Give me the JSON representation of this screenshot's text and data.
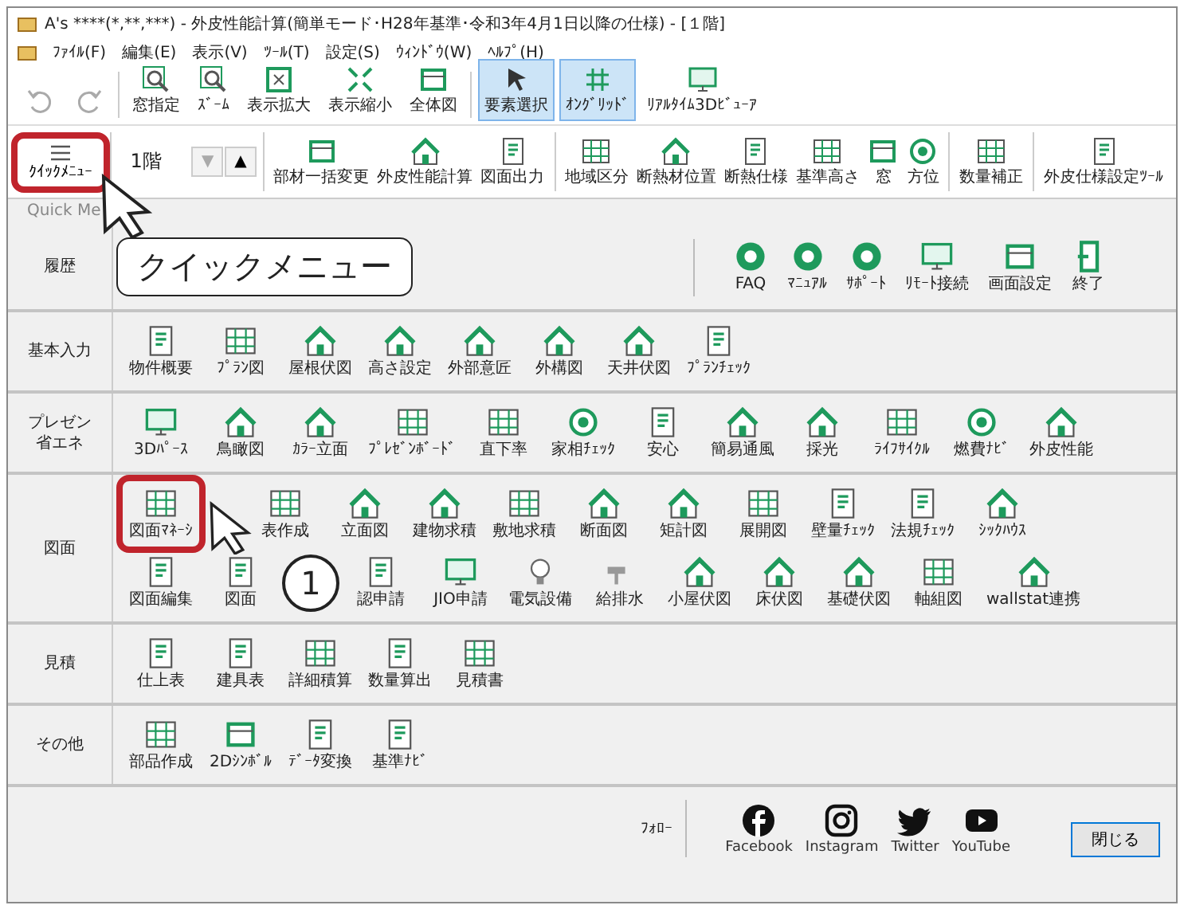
{
  "window": {
    "title": "A's ****(*,**,***) - 外皮性能計算(簡単モード･H28年基準･令和3年4月1日以降の仕様) - [１階]"
  },
  "menu_bar": [
    "ﾌｧｲﾙ(F)",
    "編集(E)",
    "表示(V)",
    "ﾂｰﾙ(T)",
    "設定(S)",
    "ｳｨﾝﾄﾞｳ(W)",
    "ﾍﾙﾌﾟ(H)"
  ],
  "toolbar": [
    {
      "disabled": true,
      "selected": false
    },
    {
      "disabled": true,
      "selected": false
    },
    {
      "label": "窓指定",
      "disabled": false,
      "selected": false
    },
    {
      "label": "ｽﾞｰﾑ",
      "disabled": false,
      "selected": false
    },
    {
      "label": "表示拡大",
      "disabled": false,
      "selected": false
    },
    {
      "label": "表示縮小",
      "disabled": false,
      "selected": false
    },
    {
      "label": "全体図",
      "disabled": false,
      "selected": false
    },
    {
      "label": "要素選択",
      "disabled": false,
      "selected": true
    },
    {
      "label": "ｵﾝｸﾞﾘｯﾄﾞ",
      "disabled": false,
      "selected": true
    },
    {
      "label": "ﾘｱﾙﾀｲﾑ3Dﾋﾞｭｰｱ",
      "disabled": false,
      "selected": false
    }
  ],
  "toolbar2": {
    "quick_menu": "ｸｲｯｸﾒﾆｭｰ",
    "floor": "1階",
    "steppers": [
      {
        "label": "▼",
        "disabled": true
      },
      {
        "label": "▲",
        "disabled": false
      }
    ],
    "items": [
      "部材一括変更",
      "外皮性能計算",
      "図面出力",
      "地域区分",
      "断熱材位置",
      "断熱仕様",
      "基準高さ",
      "窓",
      "方位",
      "数量補正",
      "外皮仕様設定ﾂｰﾙ"
    ]
  },
  "quick_menu": {
    "title": "Quick Me",
    "history": {
      "label": "履歴",
      "links": [
        "FAQ",
        "ﾏﾆｭｱﾙ",
        "ｻﾎﾟｰﾄ",
        "ﾘﾓｰﾄ接続",
        "画面設定",
        "終了"
      ]
    },
    "sections": [
      {
        "label": "基本入力",
        "rows": [
          [
            "物件概要",
            "ﾌﾟﾗﾝ図",
            "屋根伏図",
            "高さ設定",
            "外部意匠",
            "外構図",
            "天井伏図",
            "ﾌﾟﾗﾝﾁｪｯｸ"
          ]
        ]
      },
      {
        "label": "プレゼン省エネ",
        "rows": [
          [
            "3Dﾊﾟｰｽ",
            "鳥瞰図",
            "ｶﾗｰ立面",
            "ﾌﾟﾚｾﾞﾝﾎﾞｰﾄﾞ",
            "直下率",
            "家相ﾁｪｯｸ",
            "安心",
            "簡易通風",
            "採光",
            "ﾗｲﾌｻｲｸﾙ",
            "燃費ﾅﾋﾞ",
            "外皮性能"
          ]
        ]
      },
      {
        "label": "図面",
        "rows": [
          [
            "図面ﾏﾈｰｼ",
            "表作成",
            "立面図",
            "建物求積",
            "敷地求積",
            "断面図",
            "矩計図",
            "展開図",
            "壁量ﾁｪｯｸ",
            "法規ﾁｪｯｸ",
            "ｼｯｸﾊｳｽ"
          ],
          [
            "図面編集",
            "図面",
            "認申請",
            "JIO申請",
            "電気設備",
            "給排水",
            "小屋伏図",
            "床伏図",
            "基礎伏図",
            "軸組図",
            "wallstat連携"
          ]
        ]
      },
      {
        "label": "見積",
        "rows": [
          [
            "仕上表",
            "建具表",
            "詳細積算",
            "数量算出",
            "見積書"
          ]
        ]
      },
      {
        "label": "その他",
        "rows": [
          [
            "部品作成",
            "2Dｼﾝﾎﾞﾙ",
            "ﾃﾞｰﾀ変換",
            "基準ﾅﾋﾞ"
          ]
        ]
      }
    ]
  },
  "footer": {
    "follow": "ﾌｫﾛｰ",
    "social": [
      "Facebook",
      "Instagram",
      "Twitter",
      "YouTube"
    ],
    "close": "閉じる"
  },
  "annotations": {
    "callout": "クイックメニュー",
    "step": "1"
  }
}
